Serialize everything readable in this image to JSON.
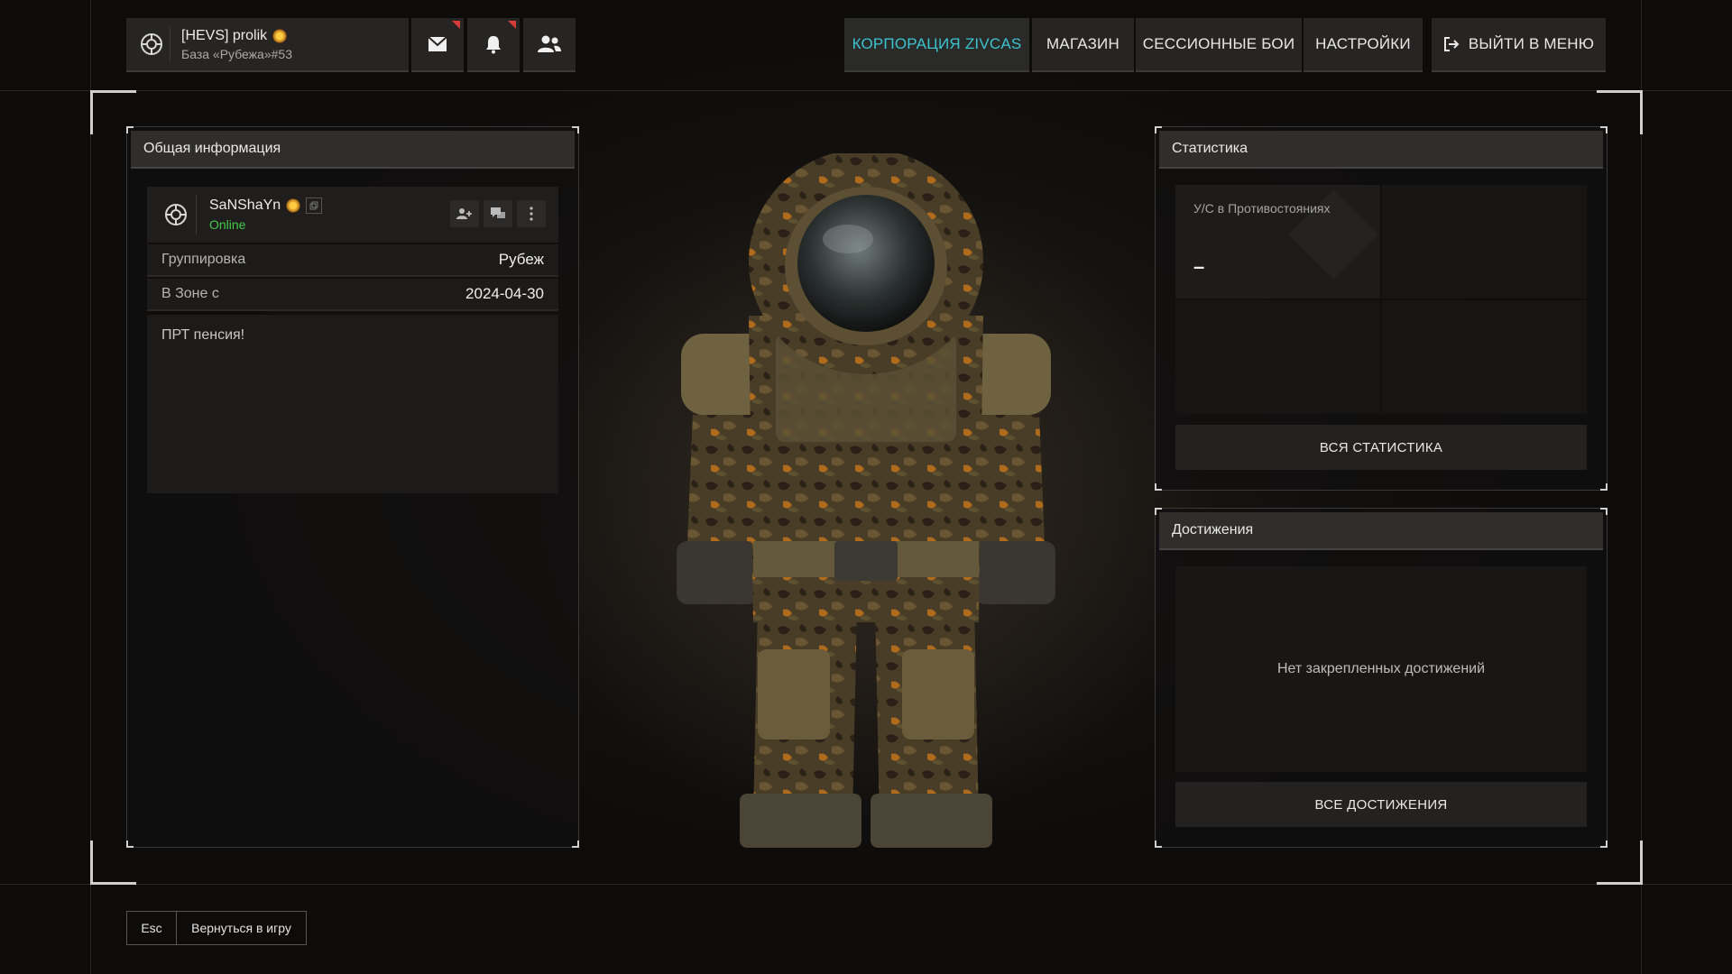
{
  "topbar": {
    "player_name": "[HEVS] prolik",
    "player_base": "База «Рубежа»#53",
    "icons": [
      "mail-icon",
      "bell-icon",
      "friends-icon"
    ],
    "nav": [
      {
        "label": "КОРПОРАЦИЯ ZIVCAS",
        "active": true
      },
      {
        "label": "МАГАЗИН",
        "active": false
      },
      {
        "label": "СЕССИОННЫЕ БОИ",
        "active": false
      },
      {
        "label": "НАСТРОЙКИ",
        "active": false
      }
    ],
    "exit_label": "ВЫЙТИ В МЕНЮ"
  },
  "general": {
    "title": "Общая информация",
    "username": "SaNShaYn",
    "status": "Online",
    "rows": [
      {
        "key": "Группировка",
        "value": "Рубеж"
      },
      {
        "key": "В Зоне с",
        "value": "2024-04-30"
      }
    ],
    "about": "ПРТ пенсия!"
  },
  "stats": {
    "title": "Статистика",
    "cells": [
      {
        "label": "У/С в Противостояниях",
        "value": "–"
      }
    ],
    "all_button": "ВСЯ СТАТИСТИКА"
  },
  "achievements": {
    "title": "Достижения",
    "empty_text": "Нет закрепленных достижений",
    "all_button": "ВСЕ ДОСТИЖЕНИЯ"
  },
  "footer": {
    "key": "Esc",
    "action": "Вернуться в игру"
  },
  "colors": {
    "accent": "#3cc3cf",
    "online": "#45c94a",
    "notify": "#d83a3a"
  }
}
